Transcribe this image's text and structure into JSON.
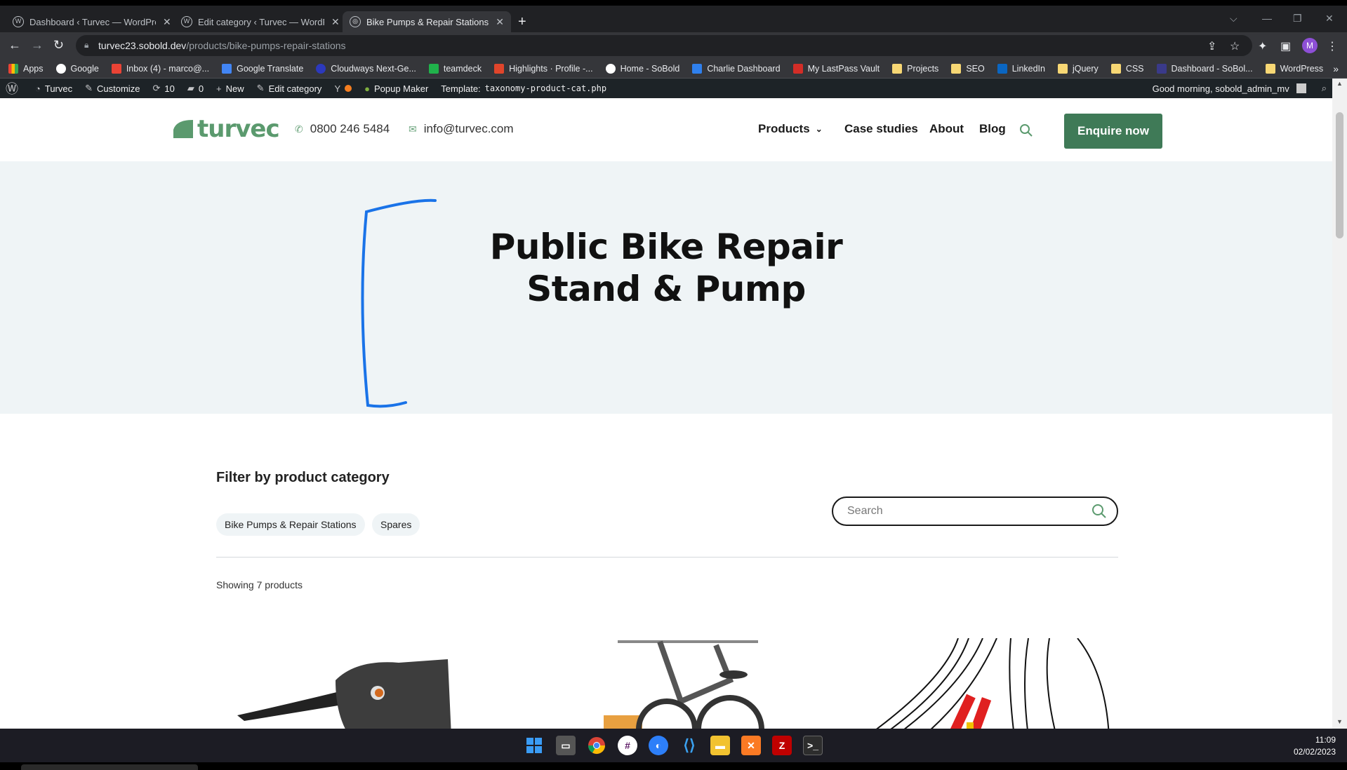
{
  "browser": {
    "tabs": [
      {
        "title": "Dashboard ‹ Turvec — WordPress",
        "active": false
      },
      {
        "title": "Edit category ‹ Turvec — WordPress",
        "active": false
      },
      {
        "title": "Bike Pumps & Repair Stations Archives",
        "active": true
      }
    ],
    "url_host": "turvec23.sobold.dev",
    "url_path": "/products/bike-pumps-repair-stations",
    "profile_initial": "M",
    "bookmarks": [
      {
        "label": "Apps",
        "icon": "apps-grid-icon",
        "color": "#e8453c"
      },
      {
        "label": "Google",
        "icon": "google-icon",
        "color": "#4285f4"
      },
      {
        "label": "Inbox (4) - marco@...",
        "icon": "gmail-icon",
        "color": "#ea4335"
      },
      {
        "label": "Google Translate",
        "icon": "translate-icon",
        "color": "#4285f4"
      },
      {
        "label": "Cloudways Next-Ge...",
        "icon": "cloudways-icon",
        "color": "#2c39bd"
      },
      {
        "label": "teamdeck",
        "icon": "teamdeck-icon",
        "color": "#20b24b"
      },
      {
        "label": "Highlights · Profile -...",
        "icon": "highlights-icon",
        "color": "#e0452b"
      },
      {
        "label": "Home - SoBold",
        "icon": "sobold-icon",
        "color": "#ffffff"
      },
      {
        "label": "Charlie Dashboard",
        "icon": "charlie-icon",
        "color": "#2f80ed"
      },
      {
        "label": "My LastPass Vault",
        "icon": "lastpass-icon",
        "color": "#d32d27"
      },
      {
        "label": "Projects",
        "icon": "folder-icon",
        "color": "#f7d774"
      },
      {
        "label": "SEO",
        "icon": "folder-icon",
        "color": "#f7d774"
      },
      {
        "label": "LinkedIn",
        "icon": "linkedin-icon",
        "color": "#0a66c2"
      },
      {
        "label": "jQuery",
        "icon": "folder-icon",
        "color": "#f7d774"
      },
      {
        "label": "CSS",
        "icon": "folder-icon",
        "color": "#f7d774"
      },
      {
        "label": "Dashboard - SoBol...",
        "icon": "sobold-dashboard-icon",
        "color": "#3a3a8a"
      },
      {
        "label": "WordPress",
        "icon": "folder-icon",
        "color": "#f7d774"
      }
    ]
  },
  "wp_admin_bar": {
    "site": "Turvec",
    "customize": "Customize",
    "updates": "10",
    "comments": "0",
    "new": "New",
    "edit": "Edit category",
    "popup": "Popup Maker",
    "template_label": "Template:",
    "template_file": "taxonomy-product-cat.php",
    "greeting": "Good morning, sobold_admin_mv"
  },
  "site": {
    "logo": "turvec",
    "phone": "0800 246 5484",
    "email": "info@turvec.com",
    "nav": [
      "Products",
      "Case studies",
      "About",
      "Blog"
    ],
    "cta": "Enquire now",
    "brand_color": "#3f7a57",
    "hero_title_line1": "Public Bike Repair",
    "hero_title_line2": "Stand & Pump",
    "filter_title": "Filter by product category",
    "chips": [
      "Bike Pumps & Repair Stations",
      "Spares"
    ],
    "search_placeholder": "Search",
    "showing": "Showing 7 products"
  },
  "taskbar": {
    "apps": [
      "windows-start-icon",
      "task-view-icon",
      "chrome-icon",
      "slack-icon",
      "firefox-icon",
      "vscode-icon",
      "file-explorer-icon",
      "xampp-icon",
      "filezilla-icon",
      "terminal-icon"
    ],
    "time": "11:09",
    "date": "02/02/2023"
  }
}
